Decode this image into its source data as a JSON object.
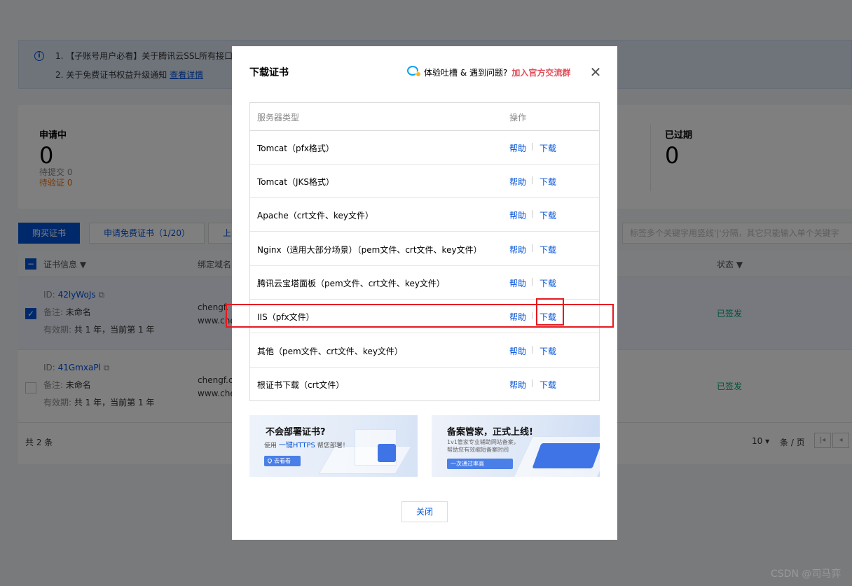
{
  "background": {
    "notice": {
      "line1": "1. 【子账号用户必看】关于腾讯云SSL所有接口",
      "line2": "2. 关于免费证书权益升级通知",
      "line2_link": "查看详情"
    },
    "stats": {
      "applying": {
        "label": "申请中",
        "value": "0",
        "sub1": "待提交 0",
        "sub2": "待验证 0"
      },
      "expired": {
        "label": "已过期",
        "value": "0"
      }
    },
    "toolbar": {
      "buy": "购买证书",
      "apply_free": "申请免费证书（1/20）",
      "upload": "上",
      "search_placeholder": "标签多个关键字用竖线'|'分隔，其它只能输入单个关键字"
    },
    "table": {
      "col_info": "证书信息",
      "col_domain": "绑定域名",
      "col_status": "状态",
      "rows": [
        {
          "id_label": "ID:",
          "id": "42lyWoJs",
          "remark_label": "备注:",
          "remark": "未命名",
          "validity_label": "有效期:",
          "validity": "共 1 年，当前第 1 年",
          "domain1": "chengf.",
          "domain2": "www.che",
          "status": "已签发"
        },
        {
          "id_label": "ID:",
          "id": "41GmxaPl",
          "remark_label": "备注:",
          "remark": "未命名",
          "validity_label": "有效期:",
          "validity": "共 1 年，当前第 1 年",
          "domain1": "chengf.co",
          "domain2": "www.che",
          "status": "已签发"
        }
      ],
      "total": "共 2 条",
      "page_size": "10",
      "per_page": "条 / 页"
    }
  },
  "modal": {
    "title": "下载证书",
    "feedback_text": "体验吐槽 & 遇到问题?",
    "feedback_link": "加入官方交流群",
    "table_header": {
      "server_type": "服务器类型",
      "action": "操作"
    },
    "rows": [
      {
        "name": "Tomcat（pfx格式）",
        "help": "帮助",
        "download": "下载"
      },
      {
        "name": "Tomcat（JKS格式）",
        "help": "帮助",
        "download": "下载"
      },
      {
        "name": "Apache（crt文件、key文件）",
        "help": "帮助",
        "download": "下载"
      },
      {
        "name": "Nginx（适用大部分场景）（pem文件、crt文件、key文件）",
        "help": "帮助",
        "download": "下载"
      },
      {
        "name": "腾讯云宝塔面板（pem文件、crt文件、key文件）",
        "help": "帮助",
        "download": "下载"
      },
      {
        "name": "IIS（pfx文件）",
        "help": "帮助",
        "download": "下载"
      },
      {
        "name": "其他（pem文件、crt文件、key文件）",
        "help": "帮助",
        "download": "下载"
      },
      {
        "name": "根证书下载（crt文件）",
        "help": "帮助",
        "download": "下载"
      }
    ],
    "banner_left": {
      "title": "不会部署证书?",
      "sub_prefix": "使用",
      "sub_highlight": "一键HTTPS",
      "sub_suffix": "帮您部署！",
      "button": "去看看"
    },
    "banner_right": {
      "title": "备案管家，正式上线!",
      "line1": "1v1管家专业辅助网站备案，",
      "line2": "帮助您有效缩短备案时间",
      "button": "一次通过率高"
    },
    "close_button": "关闭"
  },
  "watermark": "CSDN @司马弈",
  "colors": {
    "accent": "#0052d9",
    "danger": "#e34d59",
    "annotation": "#e7191f",
    "success": "#00a870"
  }
}
